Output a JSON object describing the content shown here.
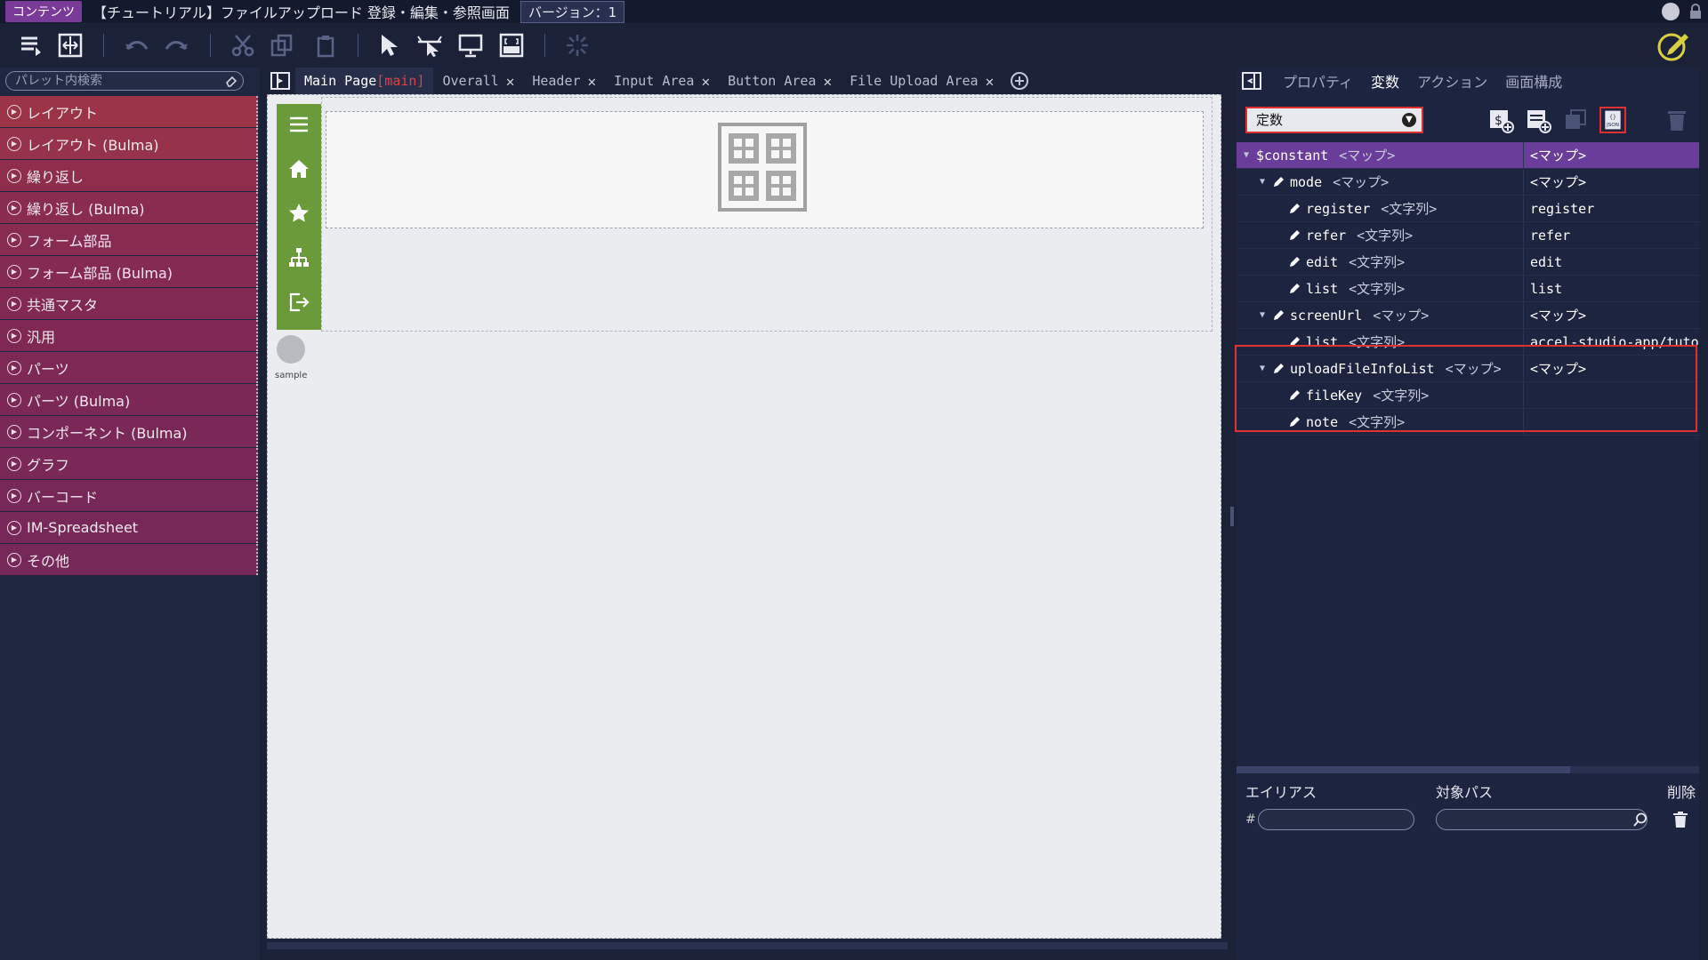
{
  "titlebar": {
    "badge": "コンテンツ",
    "title": "【チュートリアル】ファイルアップロード 登録・編集・参照画面",
    "version": "バージョン：1"
  },
  "palette": {
    "search_placeholder": "パレット内検索",
    "items": [
      {
        "label": "レイアウト",
        "color": "#9a3446"
      },
      {
        "label": "レイアウト (Bulma)",
        "color": "#963249"
      },
      {
        "label": "繰り返し",
        "color": "#8e2e4c"
      },
      {
        "label": "繰り返し (Bulma)",
        "color": "#8a2c4e"
      },
      {
        "label": "フォーム部品",
        "color": "#882b50"
      },
      {
        "label": "フォーム部品 (Bulma)",
        "color": "#852a52"
      },
      {
        "label": "共通マスタ",
        "color": "#822953"
      },
      {
        "label": "汎用",
        "color": "#802854"
      },
      {
        "label": "パーツ",
        "color": "#7e2855"
      },
      {
        "label": "パーツ (Bulma)",
        "color": "#7c2856"
      },
      {
        "label": "コンポーネント (Bulma)",
        "color": "#7a2857"
      },
      {
        "label": "グラフ",
        "color": "#792858"
      },
      {
        "label": "バーコード",
        "color": "#782858"
      },
      {
        "label": "IM-Spreadsheet",
        "color": "#772858"
      },
      {
        "label": "その他",
        "color": "#762858"
      }
    ]
  },
  "tabs": [
    {
      "label": "Main Page",
      "tag": "[main]",
      "active": true,
      "closable": false
    },
    {
      "label": "Overall",
      "active": false,
      "closable": true
    },
    {
      "label": "Header",
      "active": false,
      "closable": true
    },
    {
      "label": "Input Area",
      "active": false,
      "closable": true
    },
    {
      "label": "Button Area",
      "active": false,
      "closable": true
    },
    {
      "label": "File Upload Area",
      "active": false,
      "closable": true
    }
  ],
  "canvas": {
    "avatar_label": "sample"
  },
  "right_panel": {
    "tabs": [
      "プロパティ",
      "変数",
      "アクション",
      "画面構成"
    ],
    "active_tab": "変数",
    "scope_select": "定数",
    "tree": [
      {
        "key": "$constant",
        "type": "<マップ>",
        "value": "<マップ>",
        "level": 0,
        "expanded": true,
        "root": true
      },
      {
        "key": "mode",
        "type": "<マップ>",
        "value": "<マップ>",
        "level": 1,
        "expanded": true
      },
      {
        "key": "register",
        "type": "<文字列>",
        "value": "register",
        "level": 2
      },
      {
        "key": "refer",
        "type": "<文字列>",
        "value": "refer",
        "level": 2
      },
      {
        "key": "edit",
        "type": "<文字列>",
        "value": "edit",
        "level": 2
      },
      {
        "key": "list",
        "type": "<文字列>",
        "value": "list",
        "level": 2
      },
      {
        "key": "screenUrl",
        "type": "<マップ>",
        "value": "<マップ>",
        "level": 1,
        "expanded": true
      },
      {
        "key": "list",
        "type": "<文字列>",
        "value": "accel-studio-app/tuto",
        "level": 2
      },
      {
        "key": "uploadFileInfoList",
        "type": "<マップ>",
        "value": "<マップ>",
        "level": 1,
        "expanded": true
      },
      {
        "key": "fileKey",
        "type": "<文字列>",
        "value": "",
        "level": 2
      },
      {
        "key": "note",
        "type": "<文字列>",
        "value": "",
        "level": 2
      }
    ],
    "alias": {
      "alias_label": "エイリアス",
      "path_label": "対象パス",
      "delete_label": "削除",
      "hash": "#"
    }
  }
}
